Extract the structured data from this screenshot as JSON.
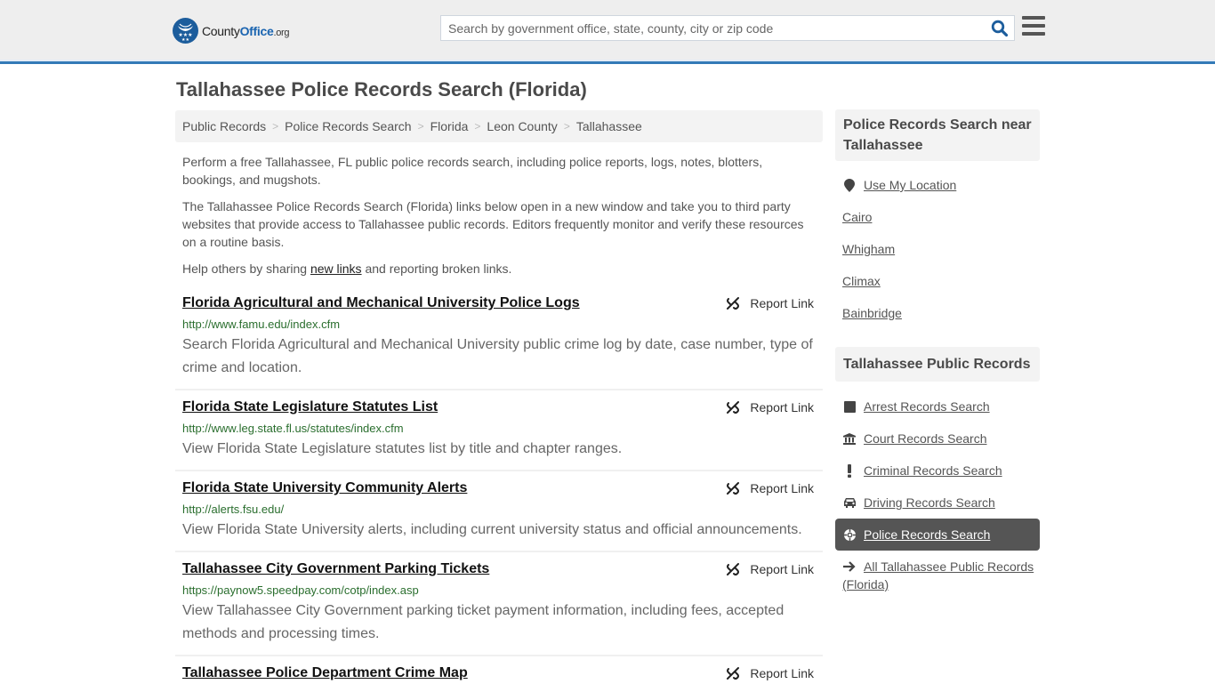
{
  "header": {
    "logo": {
      "county": "County",
      "office": "Office",
      "org": ".org"
    },
    "search": {
      "placeholder": "Search by government office, state, county, city or zip code",
      "value": ""
    },
    "icons": {
      "search": "search-icon",
      "menu": "hamburger-menu-icon"
    }
  },
  "page": {
    "title": "Tallahassee Police Records Search (Florida)"
  },
  "breadcrumb": [
    {
      "label": "Public Records"
    },
    {
      "label": "Police Records Search"
    },
    {
      "label": "Florida"
    },
    {
      "label": "Leon County"
    },
    {
      "label": "Tallahassee"
    }
  ],
  "intro": {
    "p1": "Perform a free Tallahassee, FL public police records search, including police reports, logs, notes, blotters, bookings, and mugshots.",
    "p2": "The Tallahassee Police Records Search (Florida) links below open in a new window and take you to third party websites that provide access to Tallahassee public records. Editors frequently monitor and verify these resources on a routine basis.",
    "p3_before": "Help others by sharing ",
    "p3_link": "new links",
    "p3_after": " and reporting broken links."
  },
  "results": [
    {
      "title": "Florida Agricultural and Mechanical University Police Logs",
      "url": "http://www.famu.edu/index.cfm",
      "description": "Search Florida Agricultural and Mechanical University public crime log by date, case number, type of crime and location.",
      "report_label": "Report Link"
    },
    {
      "title": "Florida State Legislature Statutes List",
      "url": "http://www.leg.state.fl.us/statutes/index.cfm",
      "description": "View Florida State Legislature statutes list by title and chapter ranges.",
      "report_label": "Report Link"
    },
    {
      "title": "Florida State University Community Alerts",
      "url": "http://alerts.fsu.edu/",
      "description": "View Florida State University alerts, including current university status and official announcements.",
      "report_label": "Report Link"
    },
    {
      "title": "Tallahassee City Government Parking Tickets",
      "url": "https://paynow5.speedpay.com/cotp/index.asp",
      "description": "View Tallahassee City Government parking ticket payment information, including fees, accepted methods and processing times.",
      "report_label": "Report Link"
    },
    {
      "title": "Tallahassee Police Department Crime Map",
      "url": "",
      "description": "",
      "report_label": "Report Link"
    }
  ],
  "sidebar": {
    "nearby": {
      "heading": "Police Records Search near Tallahassee",
      "use_location": "Use My Location",
      "cities": [
        "Cairo",
        "Whigham",
        "Climax",
        "Bainbridge"
      ]
    },
    "public_records": {
      "heading": "Tallahassee Public Records",
      "items": [
        {
          "label": "Arrest Records Search",
          "icon": "square-icon",
          "active": false
        },
        {
          "label": "Court Records Search",
          "icon": "courthouse-icon",
          "active": false
        },
        {
          "label": "Criminal Records Search",
          "icon": "exclamation-icon",
          "active": false
        },
        {
          "label": "Driving Records Search",
          "icon": "car-icon",
          "active": false
        },
        {
          "label": "Police Records Search",
          "icon": "crosshair-icon",
          "active": true
        }
      ],
      "all_link": "All Tallahassee Public Records (Florida)"
    }
  },
  "colors": {
    "accent": "#337ab7",
    "header_bg": "#eeeeee",
    "url_green": "#2a6e2e",
    "active_bg": "#555555"
  }
}
